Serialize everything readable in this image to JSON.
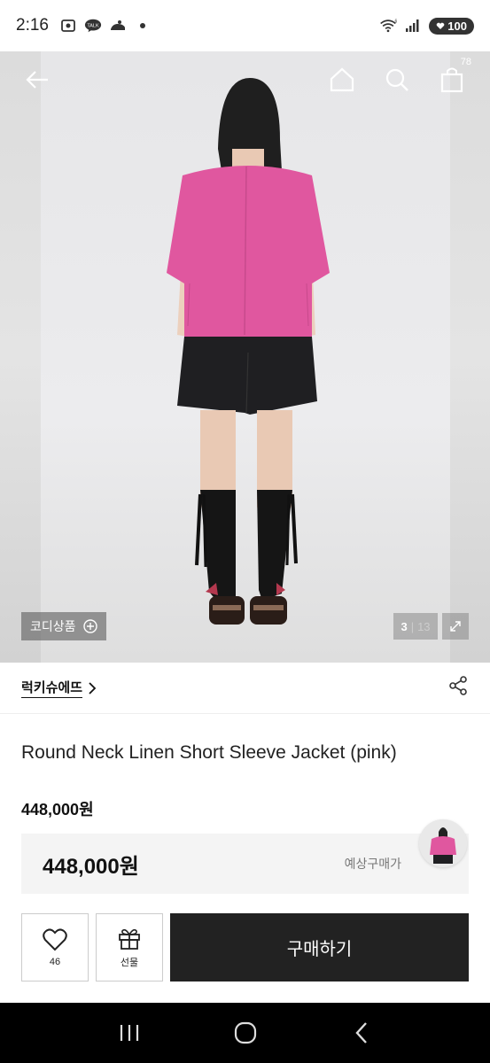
{
  "status_bar": {
    "time": "2:16",
    "battery": "100",
    "talk_icon_text": "TALK",
    "network": "6"
  },
  "gallery": {
    "current": "3",
    "separator": "|",
    "total": "13",
    "codi_label": "코디상품",
    "cart_count": "78"
  },
  "brand": {
    "name": "럭키슈에뜨"
  },
  "product": {
    "title": "Round Neck Linen Short Sleeve Jacket (pink)",
    "price": "448,000원",
    "expected_price": "448,000원",
    "expected_label": "예상구매가"
  },
  "actions": {
    "like_count": "46",
    "gift_label": "선물",
    "buy_label": "구매하기"
  },
  "colors": {
    "jacket": "#e0579f",
    "buy_button": "#222222"
  },
  "icons": {
    "back": "arrow-left-icon",
    "home": "home-icon",
    "search": "search-icon",
    "cart": "shopping-bag-icon",
    "share": "share-icon",
    "like": "heart-icon",
    "gift": "gift-icon"
  }
}
